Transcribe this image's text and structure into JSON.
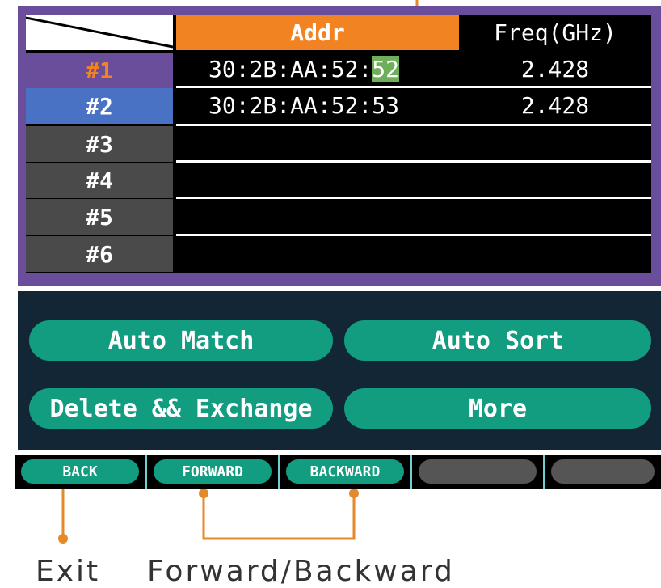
{
  "table": {
    "header": {
      "addr": "Addr",
      "freq": "Freq(GHz)"
    },
    "rows": [
      {
        "index": "#1",
        "addr_prefix": "30:2B:AA:52:",
        "addr_highlight": "52",
        "freq": "2.428"
      },
      {
        "index": "#2",
        "addr_prefix": "30:2B:AA:52:53",
        "addr_highlight": "",
        "freq": "2.428"
      },
      {
        "index": "#3",
        "addr_prefix": "",
        "addr_highlight": "",
        "freq": ""
      },
      {
        "index": "#4",
        "addr_prefix": "",
        "addr_highlight": "",
        "freq": ""
      },
      {
        "index": "#5",
        "addr_prefix": "",
        "addr_highlight": "",
        "freq": ""
      },
      {
        "index": "#6",
        "addr_prefix": "",
        "addr_highlight": "",
        "freq": ""
      }
    ]
  },
  "actions": {
    "auto_match": "Auto Match",
    "auto_sort": "Auto Sort",
    "delete_exchange": "Delete && Exchange",
    "more": "More"
  },
  "function_keys": [
    {
      "label": "BACK"
    },
    {
      "label": "FORWARD"
    },
    {
      "label": "BACKWARD"
    },
    {
      "label": ""
    },
    {
      "label": ""
    }
  ],
  "callouts": {
    "exit": "Exit",
    "forward_backward": "Forward/Backward"
  },
  "colors": {
    "accent": "#f28322",
    "frame": "#6b4e9b",
    "selected_row_1": "#6b4e9b",
    "selected_row_2": "#4a72c4",
    "button": "#129c80",
    "panel": "#132636",
    "highlight": "#6fae5a"
  }
}
